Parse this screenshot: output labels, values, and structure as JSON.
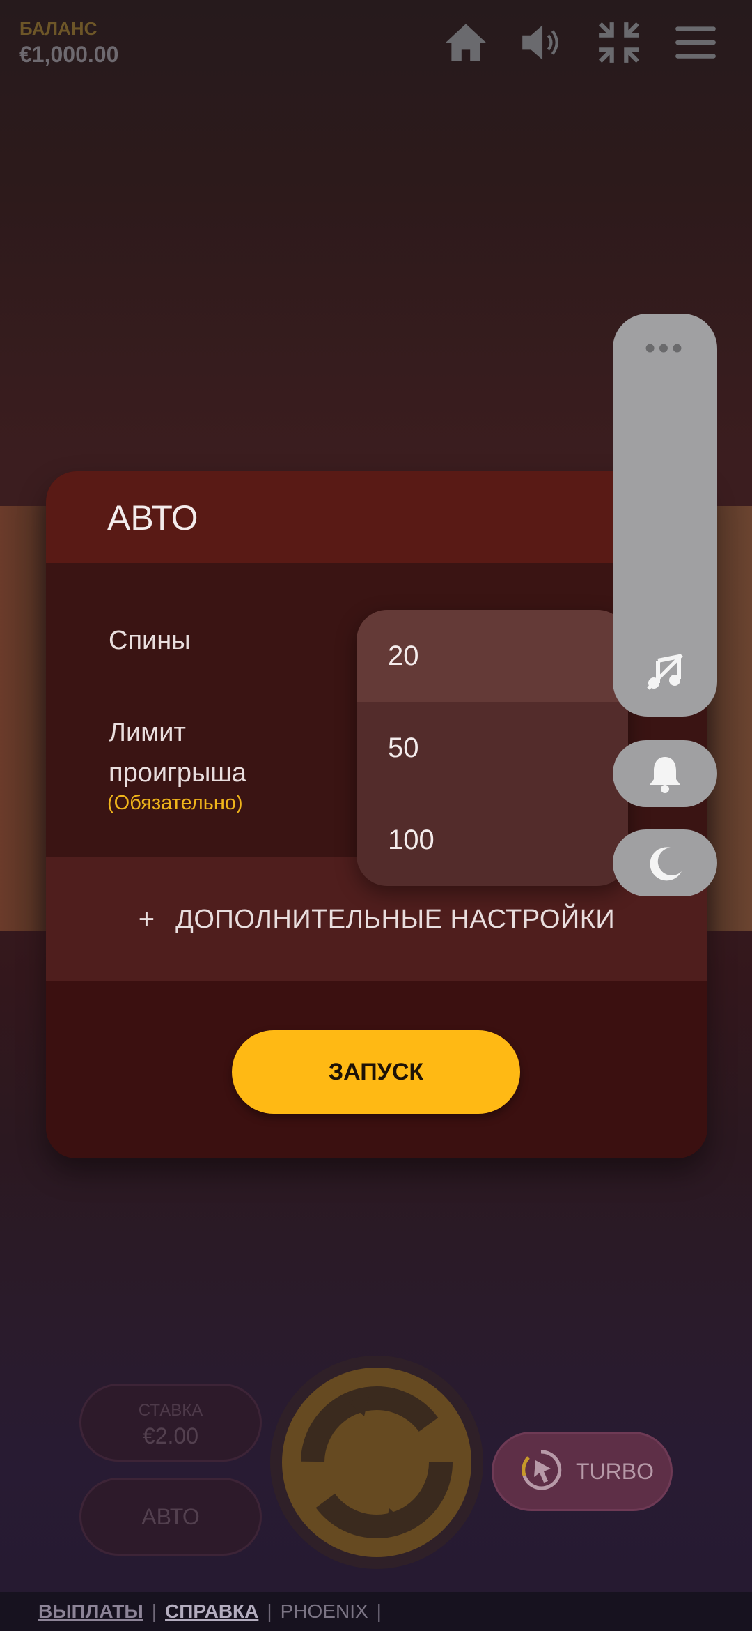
{
  "header": {
    "balance_label": "БАЛАНС",
    "balance_value": "€1,000.00",
    "icons": [
      "home-icon",
      "sound-icon",
      "exit-fullscreen-icon",
      "menu-icon"
    ]
  },
  "modal": {
    "title": "АВТО",
    "spins_label": "Спины",
    "loss_limit_label_line1": "Лимит",
    "loss_limit_label_line2": "проигрыша",
    "required_note": "(Обязательно)",
    "extra_plus": "+",
    "extra_settings": "ДОПОЛНИТЕЛЬНЫЕ НАСТРОЙКИ",
    "start_button": "ЗАПУСК"
  },
  "dropdown": {
    "options": [
      "20",
      "50",
      "100"
    ],
    "selected": "20"
  },
  "side_panel": {
    "more_dots": "•••",
    "buttons": [
      "music-off-icon",
      "bell-icon",
      "moon-icon"
    ]
  },
  "controls": {
    "bet_label": "СТАВКА",
    "bet_value": "€2.00",
    "auto_label": "АВТО",
    "turbo_label": "TURBO"
  },
  "footer": {
    "payouts": "ВЫПЛАТЫ",
    "help": "СПРАВКА",
    "game_name": "PHOENIX",
    "separator": "|"
  },
  "colors": {
    "accent": "#ffb914",
    "required": "#f0b51b",
    "modal_header": "#591a15",
    "modal_body": "#3a1413"
  }
}
